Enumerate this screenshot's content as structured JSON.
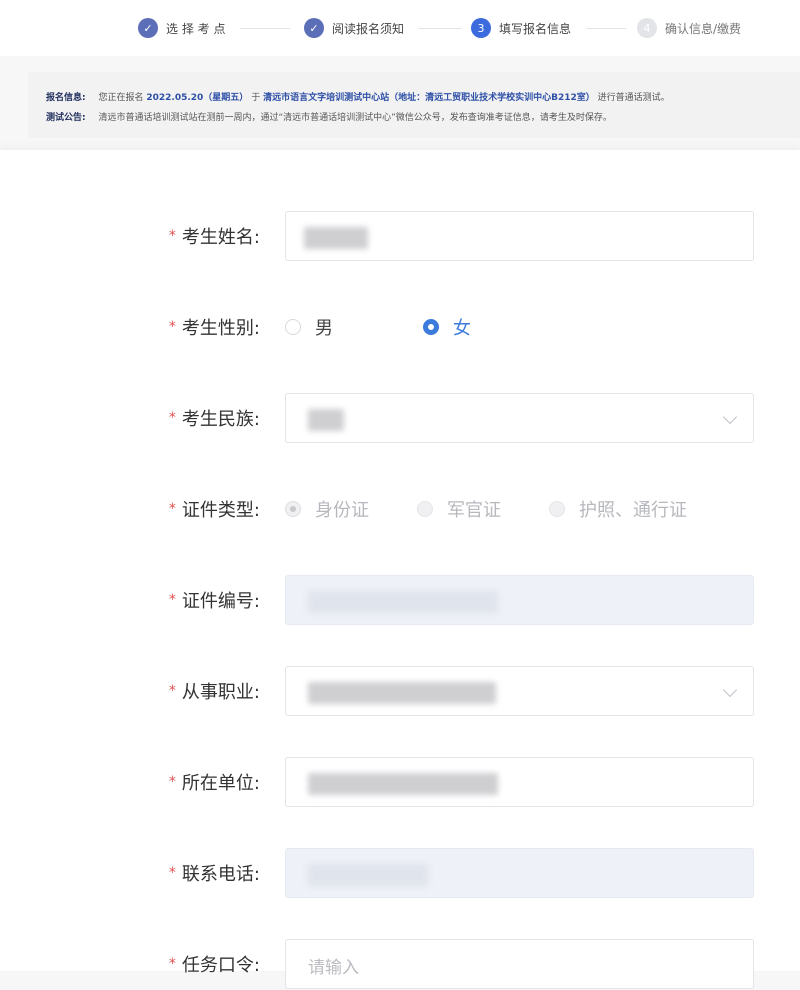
{
  "steps": [
    {
      "label": "选 择 考 点",
      "state": "done",
      "number": "✓"
    },
    {
      "label": "阅读报名须知",
      "state": "done",
      "number": "✓"
    },
    {
      "label": "填写报名信息",
      "state": "active",
      "number": "3"
    },
    {
      "label": "确认信息/缴费",
      "state": "pending",
      "number": "4"
    }
  ],
  "notice": {
    "reg_label": "报名信息:",
    "reg_pre": "您正在报名",
    "reg_date": "2022.05.20（星期五）",
    "reg_mid": "于",
    "reg_site": "清远市语言文字培训测试中心站（地址：清远工贸职业技术学校实训中心B212室）",
    "reg_post": "进行普通话测试。",
    "test_label": "测试公告:",
    "test_text": "清远市普通话培训测试站在测前一周内，通过“清远市普通话培训测试中心”微信公众号，发布查询准考证信息，请考生及时保存。"
  },
  "form": {
    "required_mark": "*",
    "name_label": "考生姓名:",
    "gender_label": "考生性别:",
    "gender_options": [
      "男",
      "女"
    ],
    "gender_selected": "女",
    "ethnicity_label": "考生民族:",
    "id_type_label": "证件类型:",
    "id_type_options": [
      "身份证",
      "军官证",
      "护照、通行证"
    ],
    "id_type_selected": "身份证",
    "id_number_label": "证件编号:",
    "occupation_label": "从事职业:",
    "employer_label": "所在单位:",
    "phone_label": "联系电话:",
    "task_code_label": "任务口令:",
    "task_code_placeholder": "请输入"
  },
  "colors": {
    "accent": "#3b7bdc",
    "step_done": "#5b6fb8",
    "required": "#e05050"
  }
}
